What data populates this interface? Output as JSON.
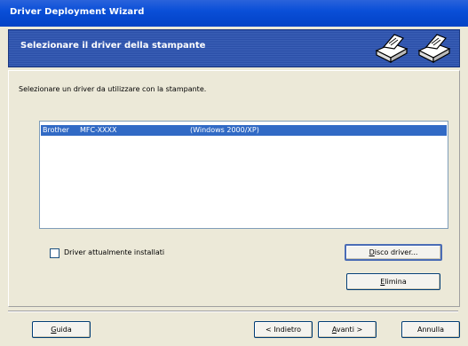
{
  "window": {
    "title": "Driver Deployment Wizard"
  },
  "banner": {
    "heading": "Selezionare il driver della stampante"
  },
  "prompt": "Selezionare un driver da utilizzare con la stampante.",
  "drivers": [
    {
      "brand": "Brother",
      "model": "MFC-XXXX",
      "os": "(Windows 2000/XP)"
    }
  ],
  "checkbox": {
    "label_pre": "D",
    "label_rest": "river attualmente installati",
    "checked": false
  },
  "buttons": {
    "disk_pre": "D",
    "disk_rest": "isco driver...",
    "delete_pre": "E",
    "delete_rest": "limina",
    "help_pre": "G",
    "help_rest": "uida",
    "back": "< Indietro",
    "next_pre": "A",
    "next_rest": "vanti >",
    "cancel": "Annulla"
  }
}
